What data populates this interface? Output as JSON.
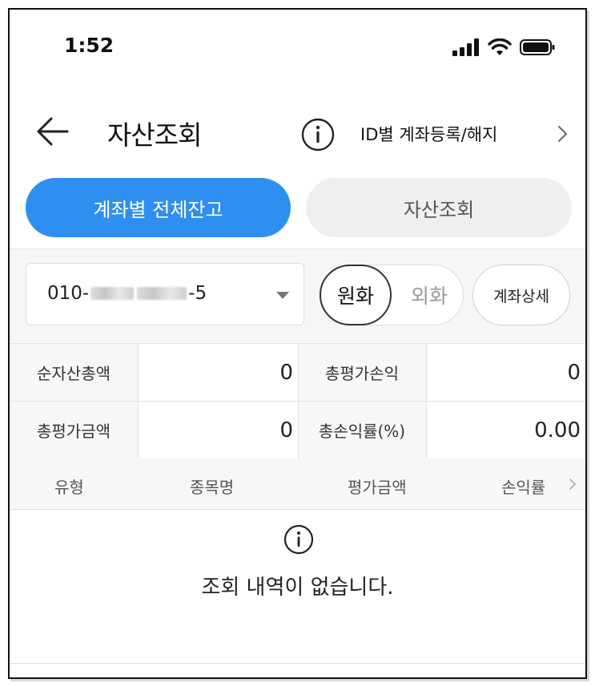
{
  "status_bar": {
    "time": "1:52"
  },
  "header": {
    "title": "자산조회",
    "id_link": "ID별 계좌등록/해지"
  },
  "tabs": {
    "left": "계좌별 전체잔고",
    "right": "자산조회"
  },
  "account": {
    "prefix": "010-",
    "suffix": "-5"
  },
  "currency": {
    "krw": "원화",
    "fx": "외화"
  },
  "detail_button": "계좌상세",
  "summary": {
    "net_assets_label": "순자산총액",
    "net_assets_value": "0",
    "total_pl_label": "총평가손익",
    "total_pl_value": "0",
    "total_eval_label": "총평가금액",
    "total_eval_value": "0",
    "total_return_label": "총손익률(%)",
    "total_return_value": "0.00"
  },
  "list_columns": {
    "type": "유형",
    "name": "종목명",
    "eval": "평가금액",
    "rate": "손익률"
  },
  "empty_message": "조회 내역이 없습니다.",
  "colors": {
    "accent": "#2f8ff0"
  }
}
